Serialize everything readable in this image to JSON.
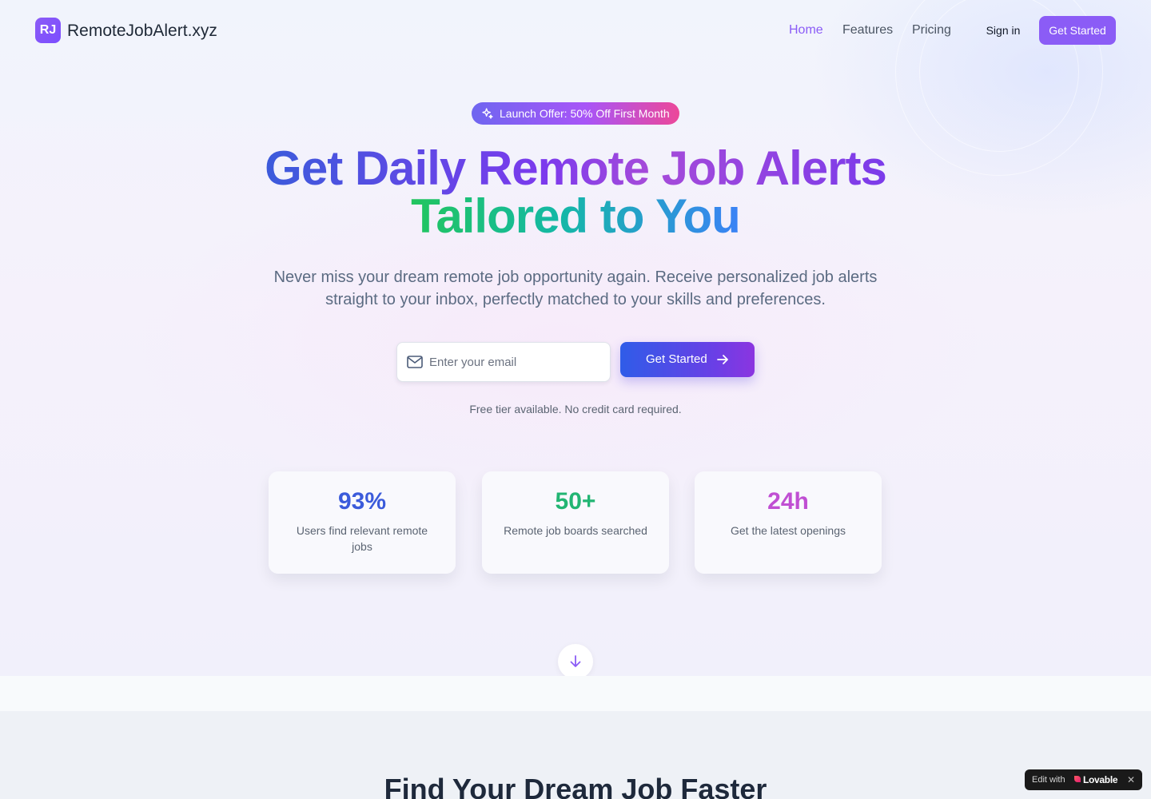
{
  "brand": {
    "badge": "RJ",
    "name": "RemoteJobAlert.xyz"
  },
  "nav": {
    "links": [
      {
        "label": "Home",
        "active": true
      },
      {
        "label": "Features",
        "active": false
      },
      {
        "label": "Pricing",
        "active": false
      }
    ],
    "signin_label": "Sign in",
    "cta_label": "Get Started"
  },
  "hero": {
    "badge_text": "Launch Offer: 50% Off First Month",
    "headline_line1": "Get Daily Remote Job Alerts",
    "headline_line2": "Tailored to You",
    "subtitle": "Never miss your dream remote job opportunity again. Receive personalized job alerts straight to your inbox, perfectly matched to your skills and preferences.",
    "email_placeholder": "Enter your email",
    "email_value": "",
    "cta_label": "Get Started",
    "note": "Free tier available. No credit card required."
  },
  "stats": [
    {
      "value": "93%",
      "label": "Users find relevant remote jobs",
      "color": "#3b5bdb"
    },
    {
      "value": "50+",
      "label": "Remote job boards searched",
      "color": "#22b573"
    },
    {
      "value": "24h",
      "label": "Get the latest openings",
      "color": "#c04fd3"
    }
  ],
  "section": {
    "title": "Find Your Dream Job Faster"
  },
  "lovable": {
    "edit_text": "Edit with",
    "brand": "Lovable",
    "close": "✕"
  },
  "colors": {
    "accent": "#8b5cf6",
    "cta_start": "#2f5ce8",
    "cta_end": "#8b35e0"
  },
  "icons": {
    "badge": "sparkles-icon",
    "email": "mail-icon",
    "cta": "arrow-right-icon",
    "scroll": "arrow-down-icon"
  }
}
